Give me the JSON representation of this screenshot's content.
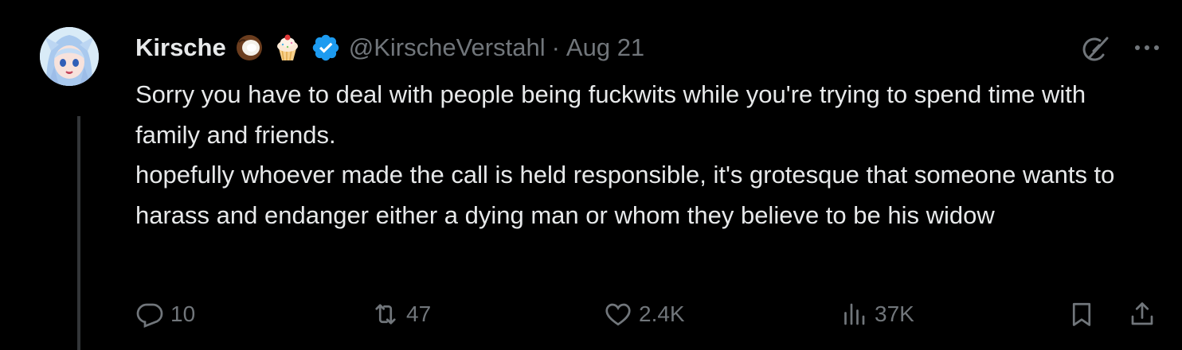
{
  "tweet": {
    "author_name": "Kirsche",
    "handle": "@KirscheVerstahl",
    "separator": "·",
    "time": "Aug 21",
    "emojis": [
      "coconut-emoji",
      "cupcake-emoji"
    ],
    "verified_color": "#1d9bf0",
    "text": "Sorry you have to deal with people being fuckwits while you're trying to spend time with family and friends.\nhopefully whoever made the call is held responsible, it's grotesque that someone wants to harass and endanger either a dying man or whom they believe to be his widow",
    "stats": {
      "replies": "10",
      "reposts": "47",
      "likes": "2.4K",
      "views": "37K"
    }
  },
  "colors": {
    "background": "#000000",
    "text": "#e7e9ea",
    "muted": "#71767b",
    "thread_line": "#333639"
  }
}
